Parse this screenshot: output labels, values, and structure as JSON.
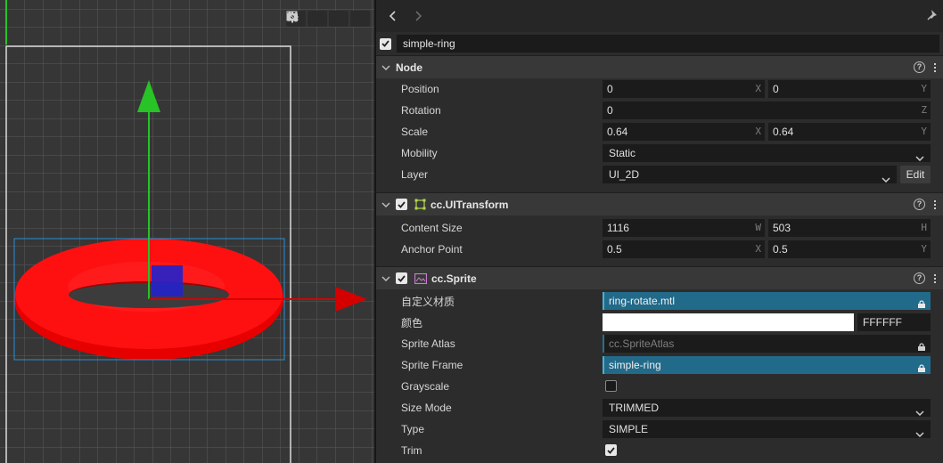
{
  "node_name": "simple-ring",
  "colors": {
    "ring": "#f20000",
    "y_axis": "#27c327",
    "x_axis": "#d40000",
    "asset_fill": "#226a8a",
    "selection": "#2b8fd6"
  },
  "scene_toolbar": [
    "layout-icon",
    "camera-icon",
    "gear-icon",
    "image-settings-icon"
  ],
  "node": {
    "title": "Node",
    "position": {
      "label": "Position",
      "x": "0",
      "y": "0",
      "x_axis": "X",
      "y_axis": "Y"
    },
    "rotation": {
      "label": "Rotation",
      "z": "0",
      "z_axis": "Z"
    },
    "scale": {
      "label": "Scale",
      "x": "0.64",
      "y": "0.64",
      "x_axis": "X",
      "y_axis": "Y"
    },
    "mobility": {
      "label": "Mobility",
      "value": "Static"
    },
    "layer": {
      "label": "Layer",
      "value": "UI_2D",
      "edit": "Edit"
    }
  },
  "uitransform": {
    "title": "cc.UITransform",
    "content_size": {
      "label": "Content Size",
      "w": "1116",
      "h": "503",
      "w_axis": "W",
      "h_axis": "H"
    },
    "anchor_point": {
      "label": "Anchor Point",
      "x": "0.5",
      "y": "0.5",
      "x_axis": "X",
      "y_axis": "Y"
    }
  },
  "sprite": {
    "title": "cc.Sprite",
    "custom_material": {
      "label": "自定义材质",
      "value": "ring-rotate.mtl"
    },
    "color": {
      "label": "颜色",
      "hex": "FFFFFF",
      "swatch": "#ffffff"
    },
    "sprite_atlas": {
      "label": "Sprite Atlas",
      "value": "cc.SpriteAtlas"
    },
    "sprite_frame": {
      "label": "Sprite Frame",
      "value": "simple-ring"
    },
    "grayscale": {
      "label": "Grayscale",
      "checked": false
    },
    "size_mode": {
      "label": "Size Mode",
      "value": "TRIMMED"
    },
    "type": {
      "label": "Type",
      "value": "SIMPLE"
    },
    "trim": {
      "label": "Trim",
      "checked": true
    }
  }
}
